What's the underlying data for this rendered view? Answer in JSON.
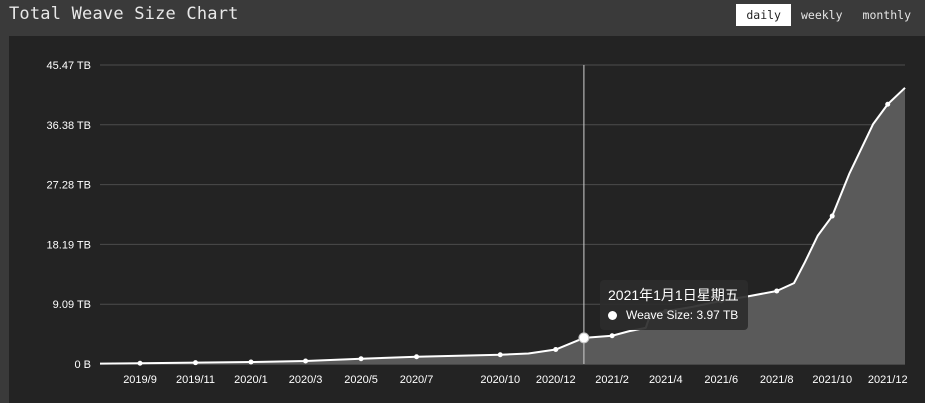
{
  "header": {
    "title": "Total Weave Size Chart",
    "buttons": [
      {
        "label": "daily",
        "active": true
      },
      {
        "label": "weekly",
        "active": false
      },
      {
        "label": "monthly",
        "active": false
      }
    ]
  },
  "tooltip": {
    "date": "2021年1月1日星期五",
    "series_label": "Weave Size: 3.97 TB"
  },
  "colors": {
    "line": "#ffffff",
    "area": "#5a5a5a",
    "grid": "#4c4c4c",
    "background": "#232323"
  },
  "chart_data": {
    "type": "area",
    "title": "Total Weave Size Chart",
    "xlabel": "",
    "ylabel": "",
    "unit": "TB",
    "y_ticks": [
      {
        "value": 0,
        "label": "0 B"
      },
      {
        "value": 9.09,
        "label": "9.09 TB"
      },
      {
        "value": 18.19,
        "label": "18.19 TB"
      },
      {
        "value": 27.28,
        "label": "27.28 TB"
      },
      {
        "value": 36.38,
        "label": "36.38 TB"
      },
      {
        "value": 45.47,
        "label": "45.47 TB"
      }
    ],
    "ylim": [
      0,
      45.47
    ],
    "x_ticks": [
      {
        "date": "2019-09-01",
        "label": "2019/9"
      },
      {
        "date": "2019-11-01",
        "label": "2019/11"
      },
      {
        "date": "2020-01-01",
        "label": "2020/1"
      },
      {
        "date": "2020-03-01",
        "label": "2020/3"
      },
      {
        "date": "2020-05-01",
        "label": "2020/5"
      },
      {
        "date": "2020-07-01",
        "label": "2020/7"
      },
      {
        "date": "2020-10-01",
        "label": "2020/10"
      },
      {
        "date": "2020-12-01",
        "label": "2020/12"
      },
      {
        "date": "2021-02-01",
        "label": "2021/2"
      },
      {
        "date": "2021-04-01",
        "label": "2021/4"
      },
      {
        "date": "2021-06-01",
        "label": "2021/6"
      },
      {
        "date": "2021-08-01",
        "label": "2021/8"
      },
      {
        "date": "2021-10-01",
        "label": "2021/10"
      },
      {
        "date": "2021-12-01",
        "label": "2021/12"
      }
    ],
    "xlim": [
      "2019-07-19",
      "2021-12-20"
    ],
    "series": [
      {
        "name": "Weave Size",
        "points": [
          [
            "2019-07-19",
            0.05
          ],
          [
            "2019-09-01",
            0.12
          ],
          [
            "2019-11-01",
            0.2
          ],
          [
            "2020-01-01",
            0.3
          ],
          [
            "2020-03-01",
            0.45
          ],
          [
            "2020-05-01",
            0.8
          ],
          [
            "2020-07-01",
            1.1
          ],
          [
            "2020-10-01",
            1.4
          ],
          [
            "2020-11-01",
            1.6
          ],
          [
            "2020-12-01",
            2.2
          ],
          [
            "2020-12-15",
            3.0
          ],
          [
            "2021-01-01",
            3.97
          ],
          [
            "2021-02-01",
            4.3
          ],
          [
            "2021-02-20",
            5.0
          ],
          [
            "2021-03-10",
            5.5
          ],
          [
            "2021-03-15",
            7.5
          ],
          [
            "2021-04-01",
            8.0
          ],
          [
            "2021-05-01",
            8.7
          ],
          [
            "2021-06-01",
            9.6
          ],
          [
            "2021-07-01",
            10.3
          ],
          [
            "2021-08-01",
            11.1
          ],
          [
            "2021-08-20",
            12.3
          ],
          [
            "2021-09-01",
            15.5
          ],
          [
            "2021-09-15",
            19.5
          ],
          [
            "2021-10-01",
            22.5
          ],
          [
            "2021-10-20",
            29.0
          ],
          [
            "2021-11-15",
            36.5
          ],
          [
            "2021-12-01",
            39.5
          ],
          [
            "2021-12-20",
            42.0
          ]
        ],
        "markers": [
          "2019-09-01",
          "2019-11-01",
          "2020-01-01",
          "2020-03-01",
          "2020-05-01",
          "2020-07-01",
          "2020-10-01",
          "2020-12-01",
          "2021-02-01",
          "2021-04-01",
          "2021-06-01",
          "2021-08-01",
          "2021-10-01",
          "2021-12-01"
        ]
      }
    ],
    "highlight": {
      "date": "2021-01-01",
      "value": 3.97
    },
    "grid": true,
    "legend": "none"
  }
}
